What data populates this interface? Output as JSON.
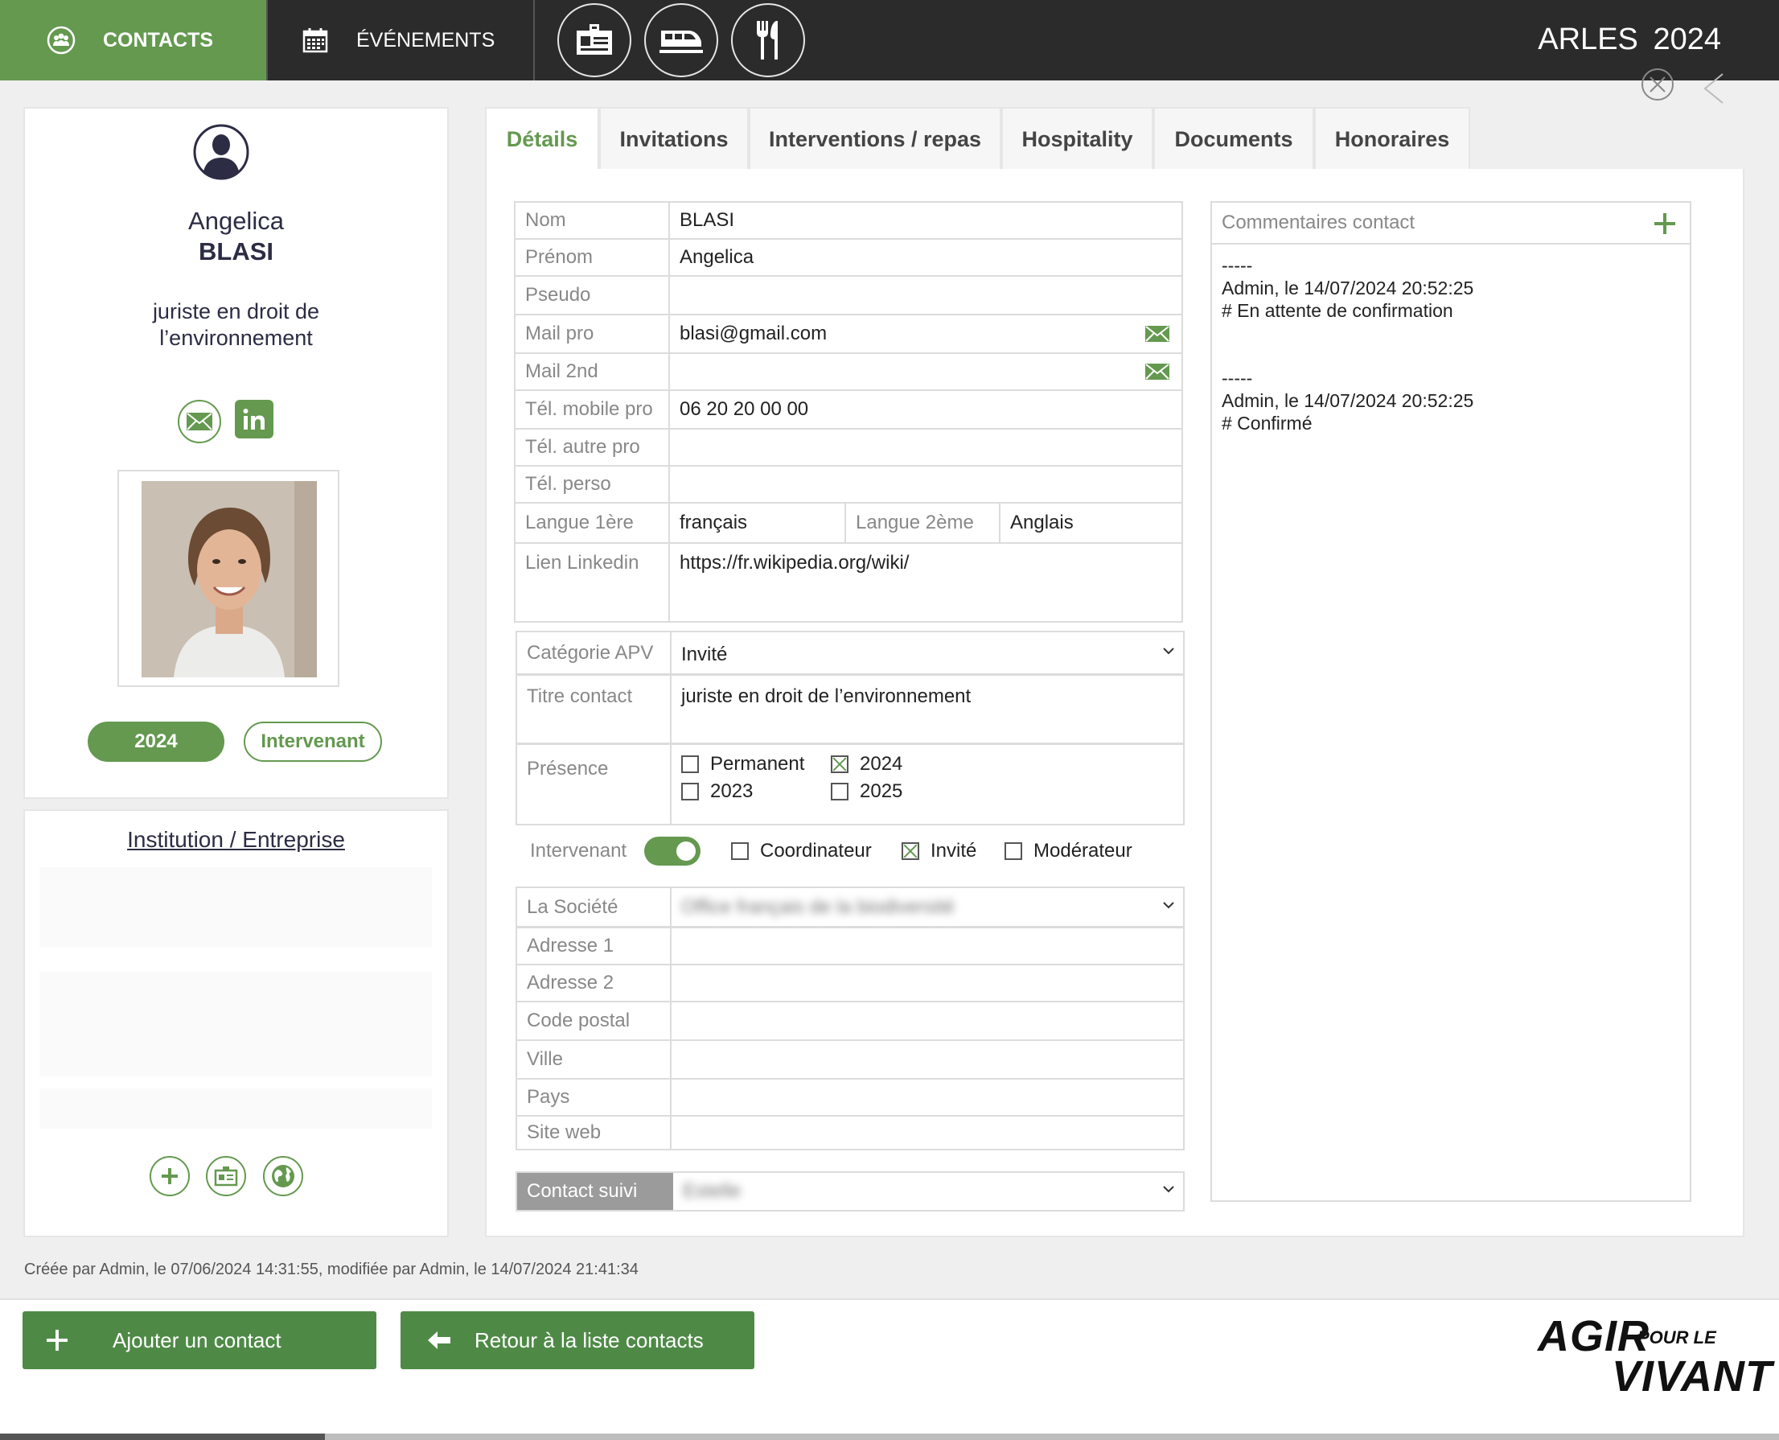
{
  "nav": {
    "contacts_label": "CONTACTS",
    "events_label": "ÉVÉNEMENTS",
    "icon_buttons": [
      "id-card-icon",
      "train-icon",
      "fork-knife-icon"
    ],
    "brand_city": "ARLES",
    "brand_year": "2024"
  },
  "profile": {
    "first_name": "Angelica",
    "last_name": "BLASI",
    "title": "juriste en droit de l’environnement",
    "year_badge": "2024",
    "role_badge": "Intervenant"
  },
  "institution": {
    "heading": "Institution / Entreprise"
  },
  "tabs": [
    "Détails",
    "Invitations",
    "Interventions / repas",
    "Hospitality",
    "Documents",
    "Honoraires"
  ],
  "identity_form": {
    "rows": [
      {
        "label": "Nom",
        "value": "BLASI"
      },
      {
        "label": "Prénom",
        "value": "Angelica"
      },
      {
        "label": "Pseudo",
        "value": ""
      },
      {
        "label": "Mail pro",
        "value": "blasi@gmail.com"
      },
      {
        "label": "Mail 2nd",
        "value": ""
      },
      {
        "label": "Tél. mobile pro",
        "value": "06 20 20 00 00"
      },
      {
        "label": "Tél. autre pro",
        "value": ""
      },
      {
        "label": "Tél. perso",
        "value": ""
      }
    ],
    "lang1_label": "Langue 1ère",
    "lang1_value": "français",
    "lang2_label": "Langue 2ème",
    "lang2_value": "Anglais",
    "linkedin_label": "Lien Linkedin",
    "linkedin_value": "https://fr.wikipedia.org/wiki/"
  },
  "category_form": {
    "category_label": "Catégorie APV",
    "category_value": "Invité",
    "title_label": "Titre contact",
    "title_value": "juriste en droit de l’environnement",
    "presence_label": "Présence",
    "presence_options": [
      {
        "label": "Permanent",
        "checked": false
      },
      {
        "label": "2024",
        "checked": true
      },
      {
        "label": "2023",
        "checked": false
      },
      {
        "label": "2025",
        "checked": false
      }
    ]
  },
  "roles": {
    "intervenant_label": "Intervenant",
    "intervenant_on": true,
    "options": [
      {
        "label": "Coordinateur",
        "checked": false
      },
      {
        "label": "Invité",
        "checked": true
      },
      {
        "label": "Modérateur",
        "checked": false
      }
    ]
  },
  "company_form": {
    "company_label": "La Société",
    "company_value": "Office français de la biodiversité",
    "rows": [
      {
        "label": "Adresse 1",
        "value": ""
      },
      {
        "label": "Adresse 2",
        "value": ""
      },
      {
        "label": "Code postal",
        "value": ""
      },
      {
        "label": "Ville",
        "value": ""
      },
      {
        "label": "Pays",
        "value": ""
      },
      {
        "label": "Site web",
        "value": ""
      }
    ],
    "followup_label": "Contact suivi",
    "followup_value": "Estelle"
  },
  "comments": {
    "title": "Commentaires contact",
    "entries": [
      {
        "sep": "-----",
        "meta": "Admin, le 14/07/2024 20:52:25",
        "text": "# En attente de confirmation"
      },
      {
        "sep": "-----",
        "meta": "Admin, le 14/07/2024 20:52:25",
        "text": "# Confirmé"
      }
    ]
  },
  "footer": {
    "audit": "Créée par Admin, le 07/06/2024 14:31:55, modifiée par Admin, le 14/07/2024 21:41:34",
    "add_label": "Ajouter un contact",
    "back_label": "Retour à la liste contacts",
    "logo_line1": "AGIR",
    "logo_small": "POUR LE",
    "logo_line2": "VIVANT"
  },
  "colors": {
    "accent": "#64994f",
    "topbar": "#2b2b2b",
    "button": "#4e8a46"
  }
}
